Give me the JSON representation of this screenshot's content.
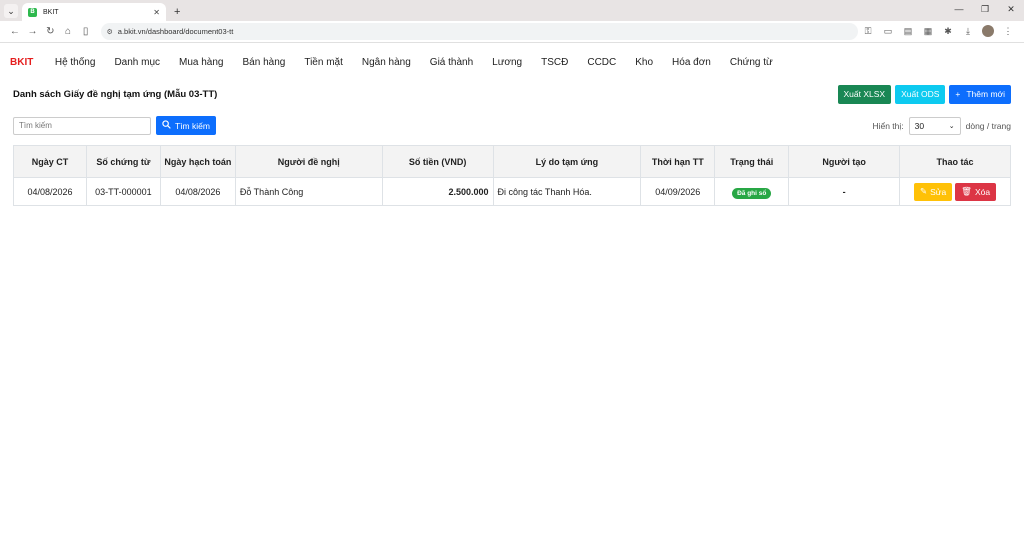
{
  "browser": {
    "tab_title": "BKIT",
    "tab_favicon": "B",
    "url": "a.bkit.vn/dashboard/document03-tt"
  },
  "nav": {
    "brand": "BKIT",
    "items": [
      "Hệ thống",
      "Danh mục",
      "Mua hàng",
      "Bán hàng",
      "Tiền mặt",
      "Ngân hàng",
      "Giá thành",
      "Lương",
      "TSCĐ",
      "CCDC",
      "Kho",
      "Hóa đơn",
      "Chứng từ"
    ]
  },
  "page": {
    "title": "Danh sách Giấy đề nghị tạm ứng (Mẫu 03-TT)",
    "export_xlsx": "Xuất XLSX",
    "export_ods": "Xuất ODS",
    "add_new": "Thêm mới",
    "search_placeholder": "Tìm kiếm",
    "search_button": "Tìm kiếm",
    "show_label": "Hiển thị:",
    "page_size": "30",
    "per_page_label": "dòng / trang"
  },
  "table": {
    "headers": [
      "Ngày CT",
      "Số chứng từ",
      "Ngày hạch toán",
      "Người đề nghị",
      "Số tiền (VND)",
      "Lý do tạm ứng",
      "Thời hạn TT",
      "Trạng thái",
      "Người tạo",
      "Thao tác"
    ],
    "rows": [
      {
        "ngay_ct": "04/08/2026",
        "so_ct": "03-TT-000001",
        "ngay_ht": "04/08/2026",
        "nguoi_de_nghi": "Đỗ Thành Công",
        "so_tien": "2.500.000",
        "ly_do": "Đi công tác Thanh Hóa.",
        "thoi_han": "04/09/2026",
        "trang_thai": "Đã ghi sổ",
        "nguoi_tao": "-",
        "edit_label": "Sửa",
        "delete_label": "Xóa"
      }
    ]
  },
  "colors": {
    "brand": "#e51e1e",
    "xlsx": "#198754",
    "ods": "#0dcaf0",
    "primary": "#0d6efd",
    "status_posted": "#28a745",
    "edit": "#ffc107",
    "delete": "#dc3545"
  }
}
